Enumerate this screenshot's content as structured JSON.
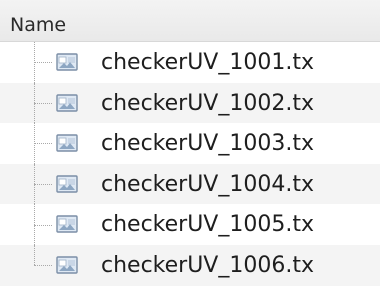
{
  "header": {
    "name_label": "Name"
  },
  "files": [
    {
      "label": "checkerUV_1001.tx",
      "icon": "image-file-icon"
    },
    {
      "label": "checkerUV_1002.tx",
      "icon": "image-file-icon"
    },
    {
      "label": "checkerUV_1003.tx",
      "icon": "image-file-icon"
    },
    {
      "label": "checkerUV_1004.tx",
      "icon": "image-file-icon"
    },
    {
      "label": "checkerUV_1005.tx",
      "icon": "image-file-icon"
    },
    {
      "label": "checkerUV_1006.tx",
      "icon": "image-file-icon"
    }
  ],
  "colors": {
    "header_bg": "#eeeeee",
    "alt_row_bg": "#f4f4f4",
    "text": "#1e1e1e",
    "icon_frame": "#7b8ea6",
    "icon_fill": "#dfe9f4"
  }
}
